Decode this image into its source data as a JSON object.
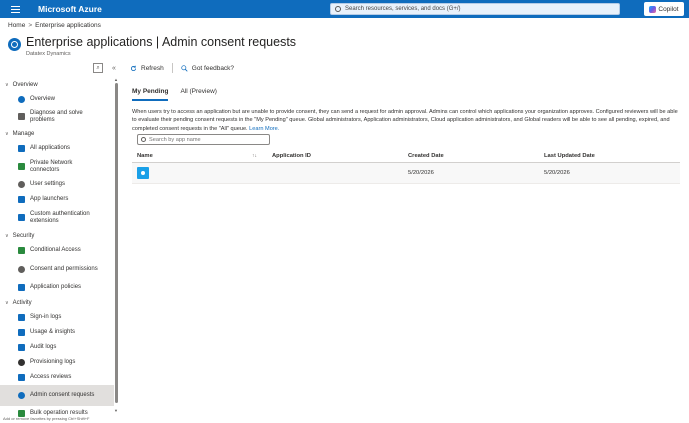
{
  "topbar": {
    "brand": "Microsoft Azure",
    "search_placeholder": "Search resources, services, and docs (G+/)",
    "copilot_label": "Copilot"
  },
  "breadcrumb": {
    "home": "Home",
    "sep": ">",
    "current": "Enterprise applications"
  },
  "header": {
    "title": "Enterprise applications | Admin consent requests",
    "more": "···",
    "subtitle": "Datatex Dynamics"
  },
  "sidebar": {
    "groups": [
      {
        "label": "Overview",
        "items": [
          {
            "label": "Overview",
            "icon": "info-icon",
            "color": "#0f6cbd"
          },
          {
            "label": "Diagnose and solve problems",
            "icon": "wrench-icon",
            "color": "#605e5c"
          }
        ]
      },
      {
        "label": "Manage",
        "items": [
          {
            "label": "All applications",
            "icon": "grid-icon",
            "color": "#0f6cbd"
          },
          {
            "label": "Private Network connectors",
            "icon": "connector-icon",
            "color": "#2a8a3e"
          },
          {
            "label": "User settings",
            "icon": "gear-icon",
            "color": "#605e5c"
          },
          {
            "label": "App launchers",
            "icon": "launcher-icon",
            "color": "#0f6cbd"
          },
          {
            "label": "Custom authentication extensions",
            "icon": "extension-icon",
            "color": "#0f6cbd"
          }
        ]
      },
      {
        "label": "Security",
        "items": [
          {
            "label": "Conditional Access",
            "icon": "shield-icon",
            "color": "#2a8a3e"
          },
          {
            "label": "Consent and permissions",
            "icon": "gear-icon",
            "color": "#605e5c"
          },
          {
            "label": "Application policies",
            "icon": "policy-icon",
            "color": "#0f6cbd"
          }
        ]
      },
      {
        "label": "Activity",
        "items": [
          {
            "label": "Sign-in logs",
            "icon": "signin-icon",
            "color": "#0f6cbd"
          },
          {
            "label": "Usage & insights",
            "icon": "chart-icon",
            "color": "#0f6cbd"
          },
          {
            "label": "Audit logs",
            "icon": "audit-icon",
            "color": "#0f6cbd"
          },
          {
            "label": "Provisioning logs",
            "icon": "person-icon",
            "color": "#323130"
          },
          {
            "label": "Access reviews",
            "icon": "review-icon",
            "color": "#0f6cbd"
          },
          {
            "label": "Admin consent requests",
            "icon": "enterprise-app-icon",
            "color": "#0f6cbd",
            "active": true
          },
          {
            "label": "Bulk operation results",
            "icon": "bulk-icon",
            "color": "#2a8a3e"
          }
        ]
      }
    ],
    "footer": "Add or remove favorites by pressing Ctrl+Shift+F"
  },
  "toolbar": {
    "refresh": "Refresh",
    "feedback": "Got feedback?"
  },
  "tabs": [
    {
      "label": "My Pending",
      "active": true
    },
    {
      "label": "All (Preview)",
      "active": false
    }
  ],
  "info": {
    "text": "When users try to access an application but are unable to provide consent, they can send a request for admin approval. Admins can control which applications your organization approves. Configured reviewers will be able to evaluate their pending consent requests in the \"My Pending\" queue. Global administrators, Application administrators, Cloud application administrators, and Global readers will be able to see all pending, expired, and completed consent requests in the \"All\" queue.",
    "link": "Learn More."
  },
  "search": {
    "placeholder": "Search by app name"
  },
  "table": {
    "headers": {
      "name": "Name",
      "app_id": "Application ID",
      "created": "Created Date",
      "updated": "Last Updated Date"
    },
    "rows": [
      {
        "name": "",
        "app_id": "",
        "created": "5/20/2026",
        "updated": "5/20/2026"
      }
    ]
  }
}
